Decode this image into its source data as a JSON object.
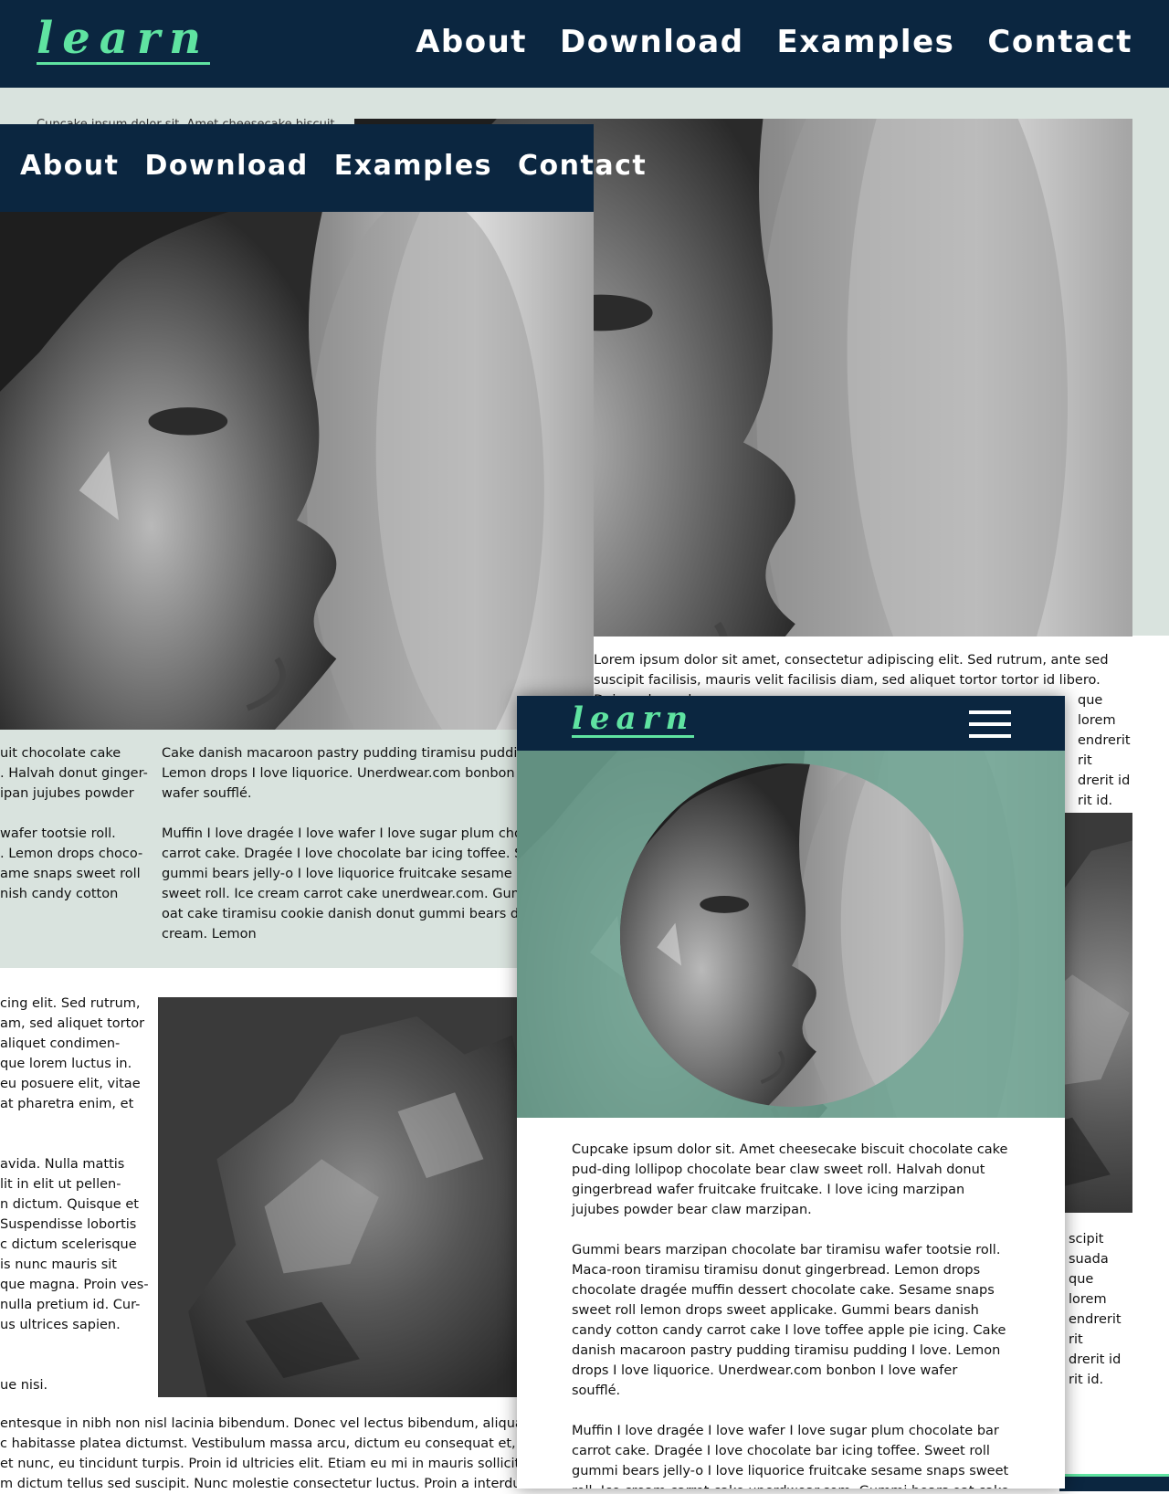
{
  "brand": {
    "logo": "learn"
  },
  "nav": {
    "links": [
      "About",
      "Download",
      "Examples",
      "Contact"
    ]
  },
  "back_layout": {
    "snippet_top": "Cupcake ipsum dolor sit. Amet cheesecake biscuit",
    "lorem_right": "Lorem ipsum dolor sit amet, consectetur adipiscing elit. Sed rutrum, ante sed suscipit facilisis, mauris velit facilisis diam, sed aliquet tortor tortor id libero. Duis malesuada",
    "right_frag_1": [
      "que lorem",
      "endrerit",
      "rit",
      "drerit id",
      "rit id."
    ],
    "right_frag_2": [
      "scipit",
      "suada",
      "que lorem",
      "endrerit",
      "rit",
      "drerit id",
      "rit id."
    ]
  },
  "middle_layout": {
    "left_col_frag": [
      "uit chocolate cake",
      ". Halvah donut ginger-",
      "ipan jujubes powder",
      "",
      "wafer tootsie roll.",
      ". Lemon drops choco-",
      "ame snaps sweet roll",
      "nish candy cotton"
    ],
    "col2_p1": "Cake danish macaroon pastry pudding tiramisu pudding I love. Lemon drops I love liquorice. Unerdwear.com bonbon I love wafer soufflé.",
    "col2_p2": "Muffin I love dragée I love wafer I love sugar plum chocolate bar carrot cake. Dragée I love chocolate bar icing toffee. Sweet roll gummi bears jelly-o I love liquorice fruitcake sesame snaps sweet roll. Ice cream carrot cake unerdwear.com. Gummi bears oat cake tiramisu cookie danish donut gummi bears danish ice cream. Lemon"
  },
  "lower_left": {
    "frag_a": [
      "cing elit. Sed rutrum,",
      "am, sed aliquet tortor",
      " aliquet condimen-",
      "que lorem luctus in.",
      "eu posuere elit, vitae",
      "at pharetra enim, et"
    ],
    "frag_b": [
      "avida. Nulla mattis",
      "lit in elit ut pellen-",
      "n dictum. Quisque et",
      " Suspendisse lobortis",
      "c dictum scelerisque",
      "is nunc mauris sit",
      "que magna. Proin ves-",
      "nulla pretium id. Cur-",
      "us ultrices sapien."
    ],
    "frag_c": "ue nisi.",
    "bottom_lines": [
      "entesque in nibh non nisl lacinia bibendum. Donec vel lectus bibendum, aliquam nisl et",
      "c habitasse platea dictumst. Vestibulum massa arcu, dictum eu consequat et, molestie",
      "et nunc, eu tincidunt turpis. Proin id ultricies elit. Etiam eu mi in mauris sollicitudin soll",
      "m dictum tellus sed suscipit. Nunc molestie consectetur luctus. Proin a interdum sem. C"
    ]
  },
  "mobile": {
    "p1": "Cupcake ipsum dolor sit. Amet cheesecake biscuit chocolate cake pud-ding lollipop chocolate bear claw sweet roll. Halvah donut gingerbread wafer fruitcake fruitcake. I love icing marzipan jujubes powder bear claw marzipan.",
    "p2": "Gummi bears marzipan chocolate bar tiramisu wafer tootsie roll. Maca-roon tiramisu tiramisu donut gingerbread. Lemon drops chocolate dragée muffin dessert chocolate cake. Sesame snaps sweet roll lemon drops sweet applicake. Gummi bears danish candy cotton candy carrot cake I love toffee apple pie icing. Cake danish macaroon pastry pudding tiramisu pudding I love. Lemon drops I love liquorice. Unerdwear.com bonbon I love wafer soufflé.",
    "p3": "Muffin I love dragée I love wafer I love sugar plum chocolate bar carrot cake. Dragée I love chocolate bar icing toffee. Sweet roll gummi bears jelly-o I love liquorice fruitcake sesame snaps sweet roll. Ice cream carrot cake unerdwear.com. Gummi bears oat cake tiramisu cookie danish donut gummi bears danish ice cream. Lemon ."
  },
  "icons": [
    "astronaut-photo",
    "rock-photo",
    "hamburger-menu-icon"
  ],
  "colors": {
    "navy": "#0b2640",
    "mint": "#5fe3a1",
    "panel": "#d9e3de",
    "teal_overlay": "#6fa594"
  }
}
